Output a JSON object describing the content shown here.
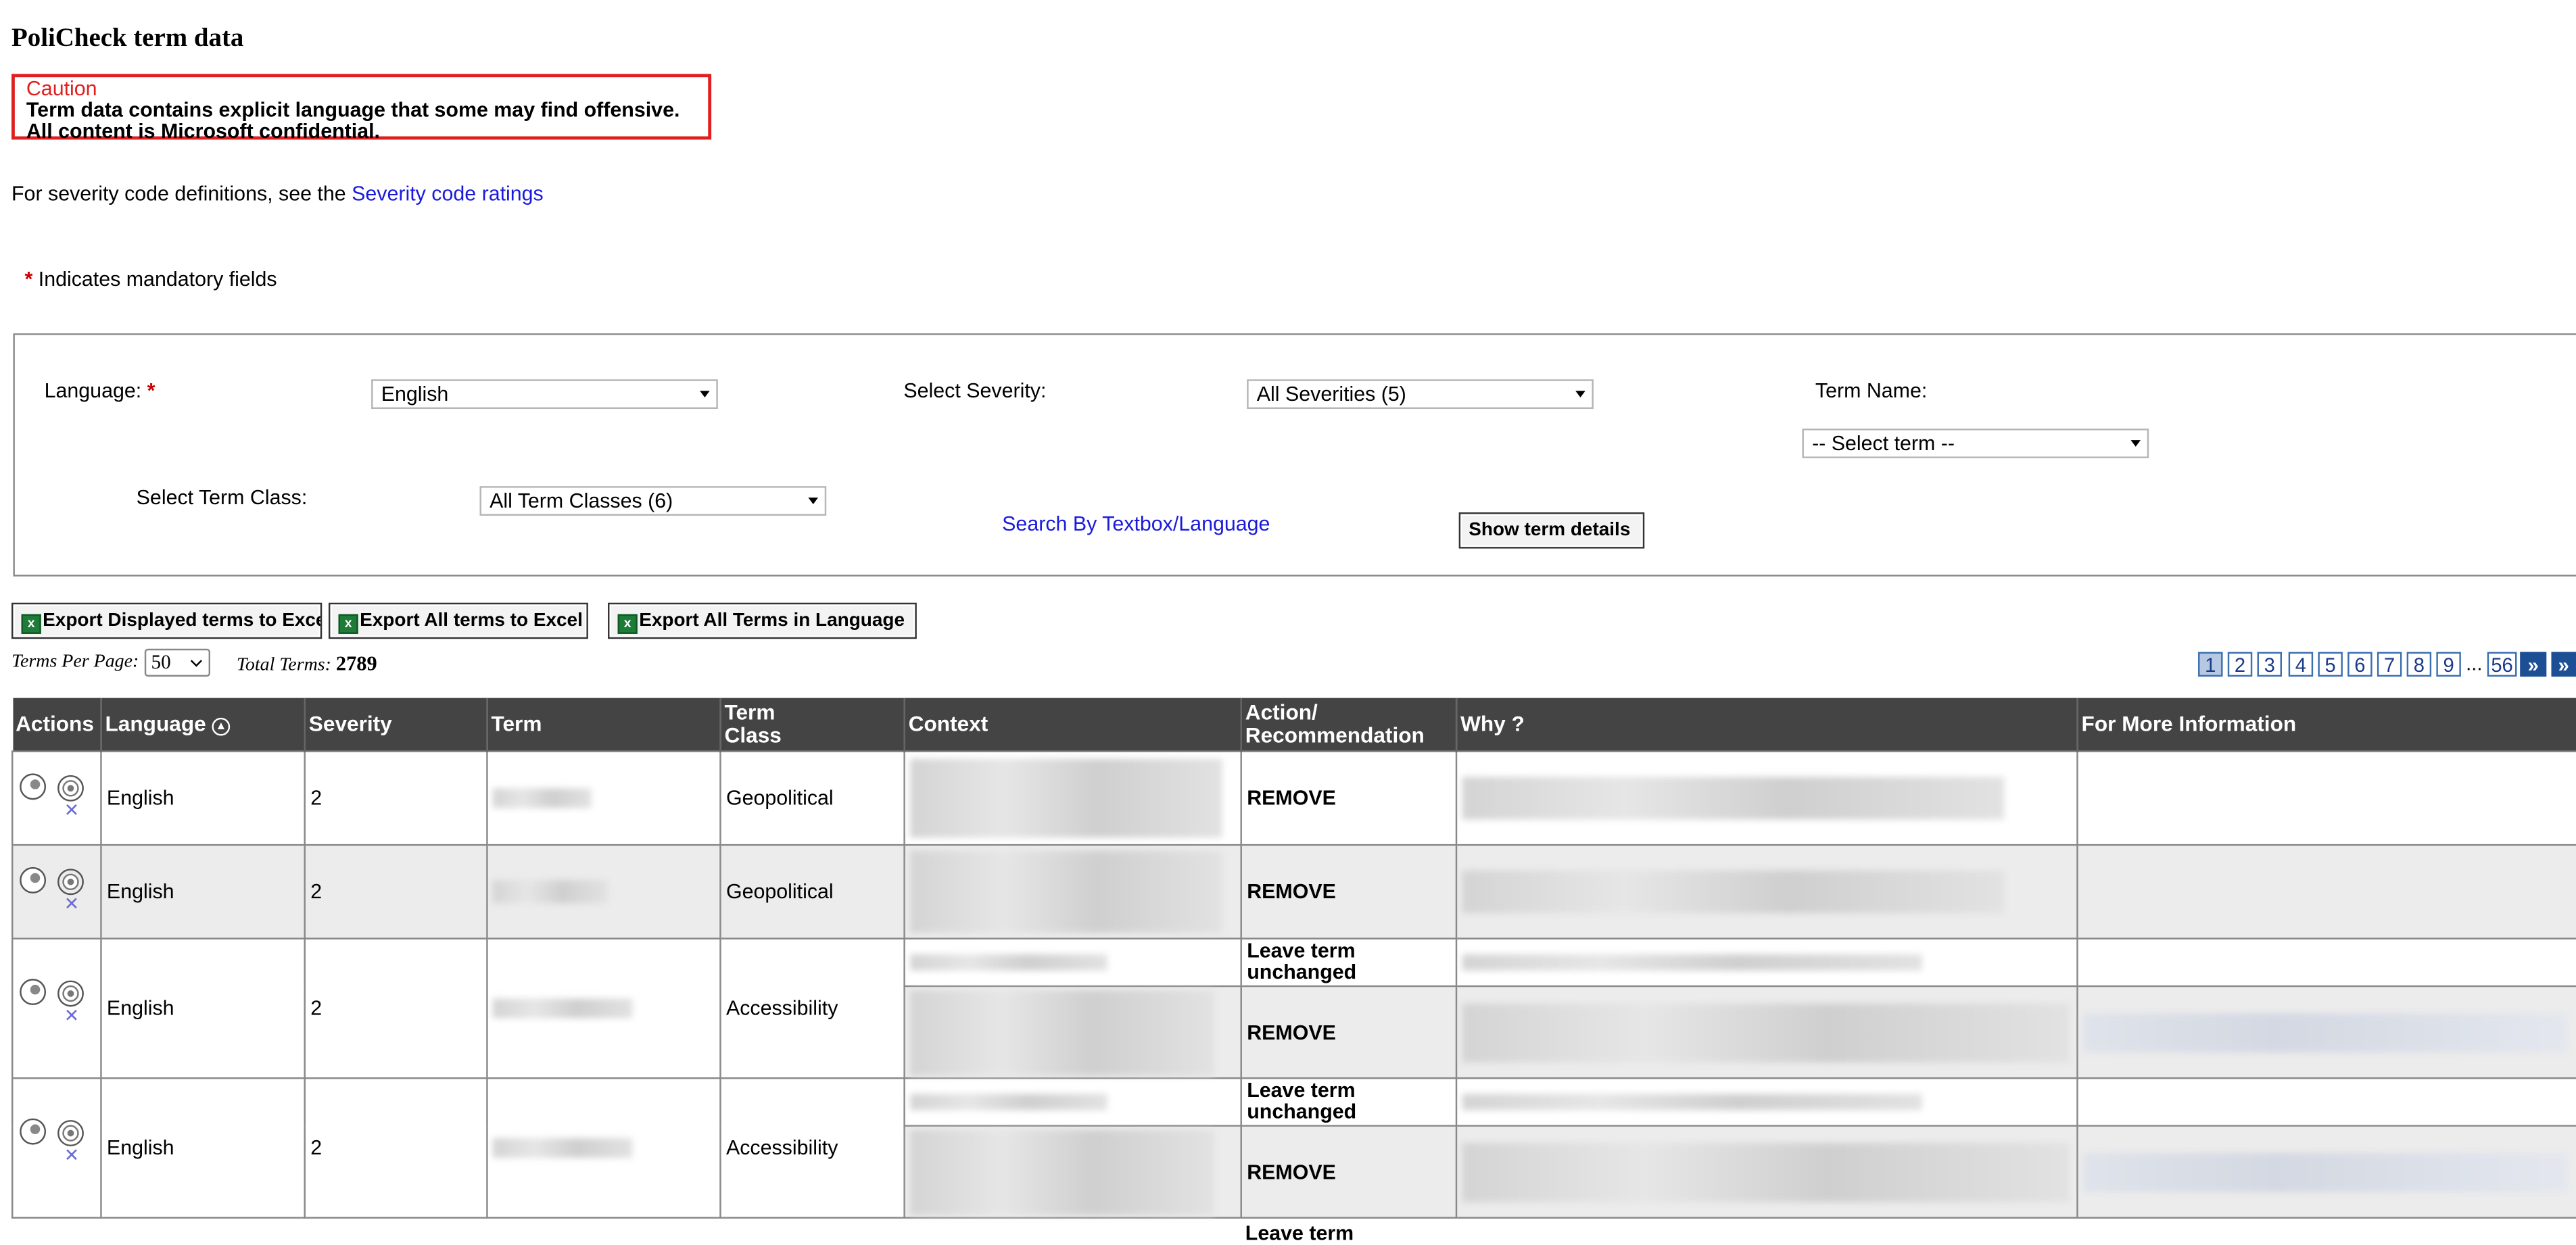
{
  "title": "PoliCheck term data",
  "caution": {
    "heading": "Caution",
    "line1": "Term data contains explicit language that some may find offensive.",
    "line2": "All content is Microsoft confidential."
  },
  "severity_note": {
    "text": "For severity code definitions, see the",
    "link": "Severity code ratings"
  },
  "mandatory_note": "Indicates mandatory fields",
  "filters": {
    "language_label": "Language:",
    "language_value": "English",
    "severity_label": "Select Severity:",
    "severity_value": "All Severities (5)",
    "term_name_label": "Term Name:",
    "term_name_value": "-- Select term --",
    "term_class_label": "Select Term Class:",
    "term_class_value": "All Term Classes (6)",
    "search_link": "Search By Textbox/Language",
    "show_details_button": "Show term details"
  },
  "export_buttons": [
    "Export Displayed terms to Excel",
    "Export All terms to Excel",
    "Export All Terms in Language"
  ],
  "paging": {
    "terms_per_page_label": "Terms Per Page:",
    "terms_per_page_value": "50",
    "total_terms_label": "Total Terms:",
    "total_terms_value": "2789",
    "pages": [
      "1",
      "2",
      "3",
      "4",
      "5",
      "6",
      "7",
      "8",
      "9"
    ],
    "ellipsis": "...",
    "last_page": "56",
    "next": "»",
    "last": "»"
  },
  "table": {
    "headers": [
      "Actions",
      "Language",
      "Severity",
      "Term",
      "Term Class",
      "Context",
      "Action/ Recommendation",
      "Why ?",
      "For More Information"
    ],
    "rows": [
      {
        "language": "English",
        "severity": "2",
        "term_class": "Geopolitical",
        "recommendations": [
          "REMOVE"
        ]
      },
      {
        "language": "English",
        "severity": "2",
        "term_class": "Geopolitical",
        "recommendations": [
          "REMOVE"
        ]
      },
      {
        "language": "English",
        "severity": "2",
        "term_class": "Accessibility",
        "recommendations": [
          "Leave term unchanged",
          "REMOVE"
        ]
      },
      {
        "language": "English",
        "severity": "2",
        "term_class": "Accessibility",
        "recommendations": [
          "Leave term unchanged",
          "REMOVE"
        ]
      }
    ],
    "cutoff_text": "Leave term"
  },
  "colors": {
    "caution_border": "#e02020",
    "link": "#1a1adc",
    "header_bg": "#444444",
    "pager_nav": "#1d4f95"
  }
}
